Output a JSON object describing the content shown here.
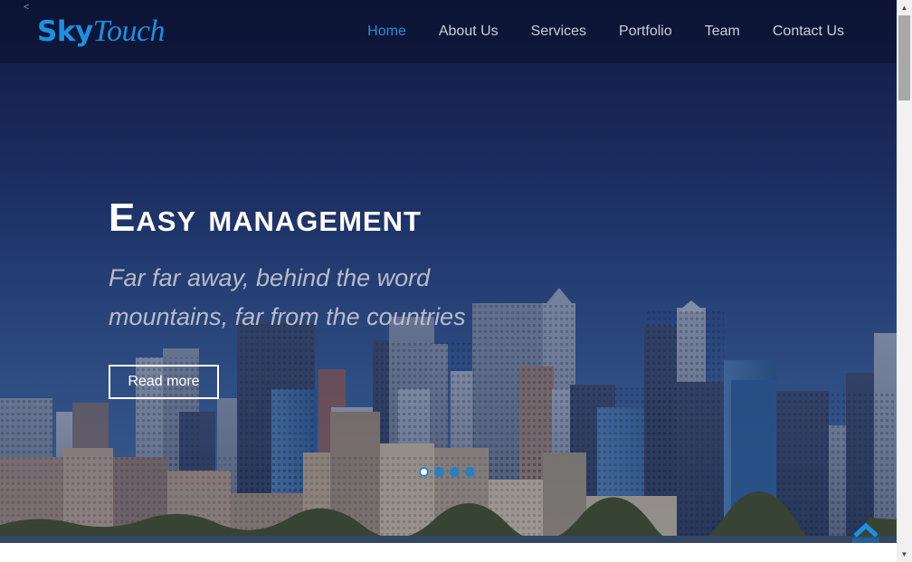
{
  "brand": {
    "logo_part1": "Sky",
    "logo_part2": "Touch",
    "accent_color": "#1e8fe1"
  },
  "nav": {
    "back_glyph": "<",
    "items": [
      {
        "label": "Home",
        "active": true
      },
      {
        "label": "About Us",
        "active": false
      },
      {
        "label": "Services",
        "active": false
      },
      {
        "label": "Portfolio",
        "active": false
      },
      {
        "label": "Team",
        "active": false
      },
      {
        "label": "Contact Us",
        "active": false
      }
    ]
  },
  "hero": {
    "title": "Easy management",
    "subtitle": "Far far away, behind the word mountains, far from the countries",
    "button_label": "Read more",
    "slides": 4,
    "active_slide": 1
  },
  "icons": {
    "scroll_top": "chevron-up-icon",
    "scroll_up": "triangle-up-icon",
    "scroll_down": "triangle-down-icon"
  }
}
